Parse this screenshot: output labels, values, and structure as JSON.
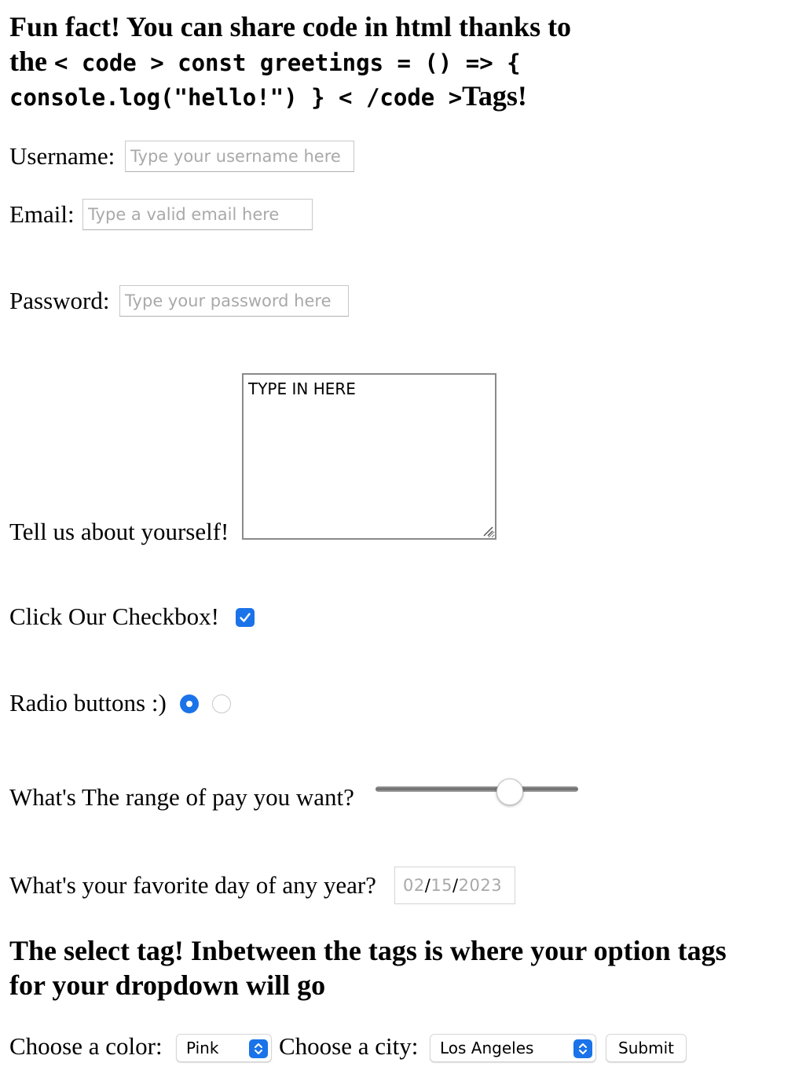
{
  "heading": {
    "line1": "Fun fact! You can share code in html thanks to",
    "line2_prefix": "the",
    "code_line1": "< code > const greetings = () => {",
    "code_line2": "console.log(\"hello!\") } < /code >",
    "line3_suffix": "Tags!"
  },
  "form": {
    "username": {
      "label": "Username:",
      "placeholder": "Type your username here",
      "value": ""
    },
    "email": {
      "label": "Email:",
      "placeholder": "Type a valid email here",
      "value": ""
    },
    "password": {
      "label": "Password:",
      "placeholder": "Type your password here",
      "value": ""
    },
    "about": {
      "label": "Tell us about yourself!",
      "value": "TYPE IN HERE"
    },
    "checkbox": {
      "label": "Click Our Checkbox!",
      "checked": true
    },
    "radio": {
      "label": "Radio buttons :)",
      "selected_index": 0
    },
    "range": {
      "label": "What's The range of pay you want?",
      "level": 0.68
    },
    "date": {
      "label": "What's your favorite day of any year?",
      "month": "02",
      "day": "15",
      "year": "2023",
      "separator": "/"
    }
  },
  "select_heading": {
    "line1": "The select tag! Inbetween the tags is where your option tags",
    "line2": "for your dropdown will go"
  },
  "dropdowns": {
    "color": {
      "label": "Choose a color:",
      "selected": "Pink"
    },
    "city": {
      "label": "Choose a city:",
      "selected": "Los Angeles"
    },
    "submit_label": "Submit"
  },
  "colors": {
    "accent": "#1a73e8",
    "placeholder": "#a9a9a9"
  },
  "icons": [
    "checkmark-icon",
    "chevron-updown-icon",
    "resize-grip-icon"
  ]
}
